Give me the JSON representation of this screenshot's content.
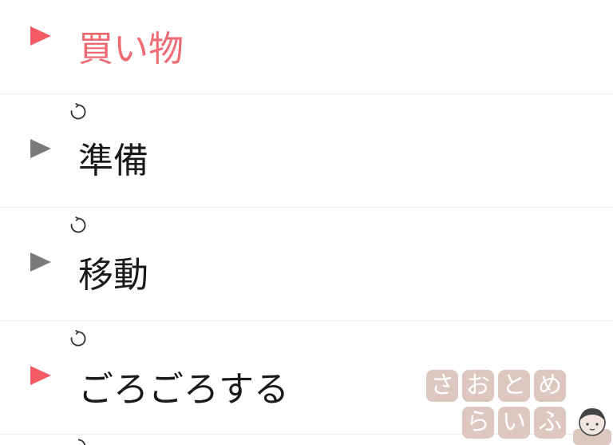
{
  "items": [
    {
      "label": "買い物",
      "play_icon": "play-triangle-icon",
      "play_color": "#f25b63",
      "label_color": "#ef6b73",
      "has_repeat": false
    },
    {
      "label": "準備",
      "play_icon": "play-triangle-icon",
      "play_color": "#7a7a7a",
      "label_color": "#1a1a1a",
      "has_repeat": true,
      "repeat_icon": "repeat-icon"
    },
    {
      "label": "移動",
      "play_icon": "play-triangle-icon",
      "play_color": "#7a7a7a",
      "label_color": "#1a1a1a",
      "has_repeat": true,
      "repeat_icon": "repeat-icon"
    },
    {
      "label": "ごろごろする",
      "play_icon": "play-triangle-icon",
      "play_color": "#f25b63",
      "label_color": "#1a1a1a",
      "has_repeat": true,
      "repeat_icon": "repeat-icon"
    }
  ],
  "watermark": {
    "line1": [
      "さ",
      "お",
      "と",
      "め"
    ],
    "line2": [
      "ら",
      "い",
      "ふ"
    ]
  },
  "colors": {
    "accent_red": "#f25b63",
    "inactive_gray": "#7a7a7a",
    "divider": "#ececec",
    "watermark_tile": "#dcc8bf"
  }
}
